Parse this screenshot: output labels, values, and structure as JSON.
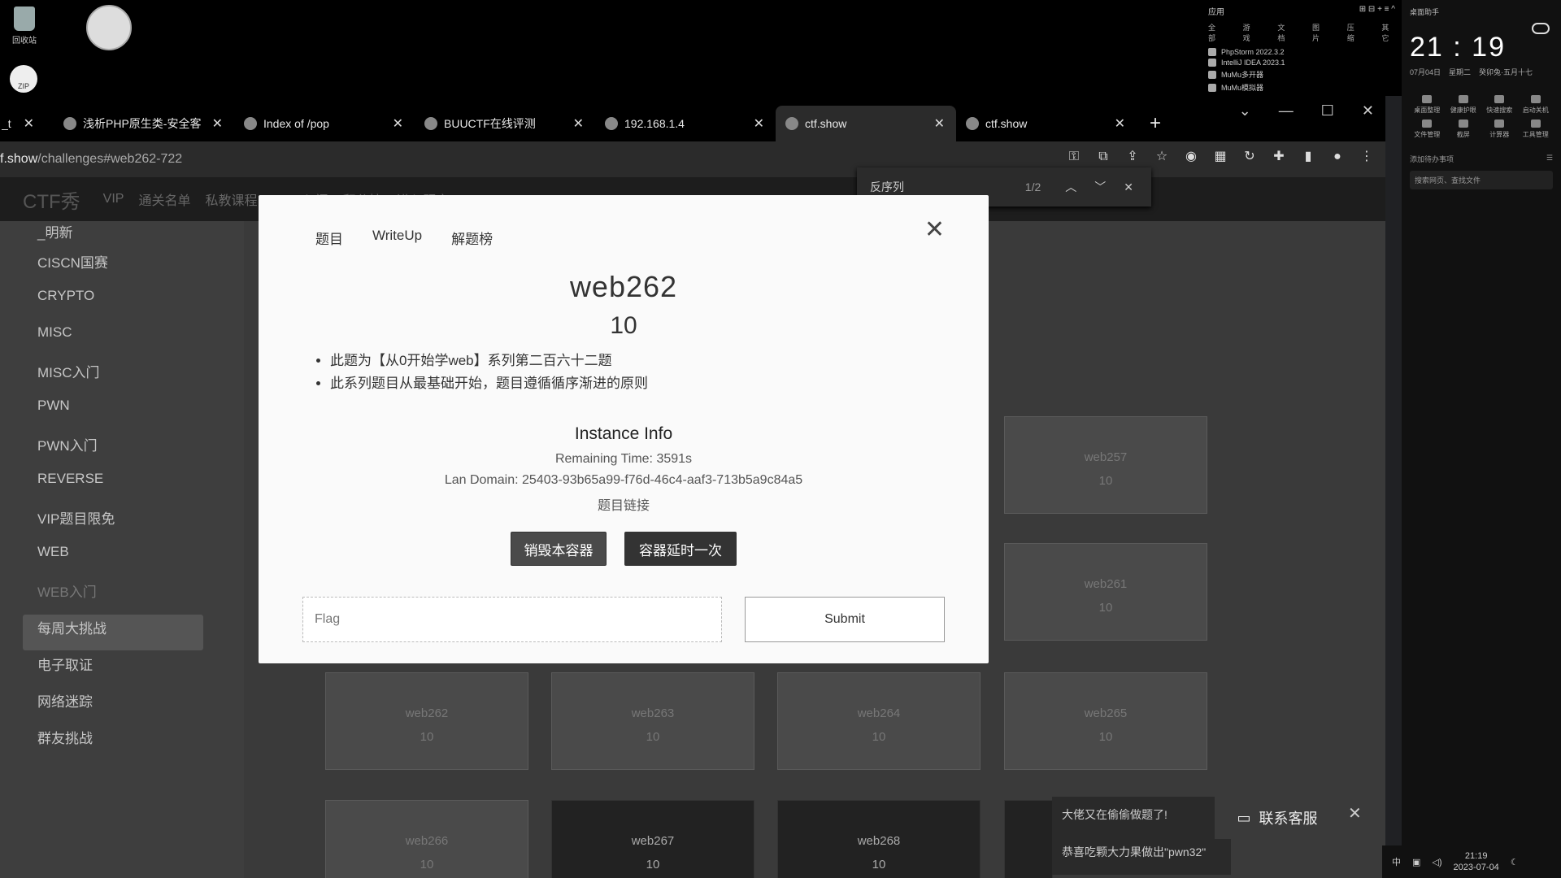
{
  "desktop": {
    "recycle_label": "回收站",
    "zip_label": "ZIP"
  },
  "apps_panel": {
    "title": "应用",
    "tabs": [
      "全部",
      "游戏",
      "文档",
      "图片",
      "压缩",
      "其它"
    ],
    "apps": [
      "PhpStorm 2022.3.2",
      "IntelliJ IDEA 2023.1",
      "MuMu多开器",
      "MuMu模拟器"
    ]
  },
  "clock": {
    "title": "桌面助手",
    "time": "21 : 19",
    "date": "07月04日",
    "weekday": "星期二",
    "lunar": "癸卯兔·五月十七",
    "tools": [
      "桌面整理",
      "健康护眼",
      "快速搜索",
      "启动关机",
      "文件管理",
      "截屏",
      "计算器",
      "工具管理"
    ],
    "todo": "添加待办事项",
    "search_placeholder": "搜索网页、查找文件"
  },
  "browser": {
    "tabs": [
      {
        "title": "_t",
        "active": false
      },
      {
        "title": "浅析PHP原生类-安全客",
        "active": false
      },
      {
        "title": "Index of /pop",
        "active": false
      },
      {
        "title": "BUUCTF在线评测",
        "active": false
      },
      {
        "title": "192.168.1.4",
        "active": false
      },
      {
        "title": "ctf.show",
        "active": true
      },
      {
        "title": "ctf.show",
        "active": false
      }
    ],
    "url_host": "f.show",
    "url_path": "/challenges#web262-722"
  },
  "find_bar": {
    "query": "反序列",
    "count": "1/2"
  },
  "site": {
    "logo": "CTF秀",
    "nav": [
      "VIP",
      "通关名单",
      "私教课程",
      "PWN入门",
      "积分榜",
      "进入题库"
    ],
    "sidebar": [
      "_明新",
      "CISCN国赛",
      "CRYPTO",
      "MISC",
      "MISC入门",
      "PWN",
      "PWN入门",
      "REVERSE",
      "VIP题目限免",
      "WEB",
      "WEB入门",
      "每周大挑战",
      "电子取证",
      "网络迷踪",
      "群友挑战"
    ],
    "cards": [
      {
        "name": "web257",
        "score": "10"
      },
      {
        "name": "web261",
        "score": "10"
      },
      {
        "name": "web262",
        "score": "10"
      },
      {
        "name": "web263",
        "score": "10"
      },
      {
        "name": "web264",
        "score": "10"
      },
      {
        "name": "web265",
        "score": "10"
      },
      {
        "name": "web266",
        "score": "10"
      },
      {
        "name": "web267",
        "score": "10"
      },
      {
        "name": "web268",
        "score": "10"
      }
    ]
  },
  "modal": {
    "tabs": [
      "题目",
      "WriteUp",
      "解题榜"
    ],
    "title": "web262",
    "score": "10",
    "desc": [
      "此题为【从0开始学web】系列第二百六十二题",
      "此系列题目从最基础开始，题目遵循循序渐进的原则"
    ],
    "instance_title": "Instance Info",
    "remaining": "Remaining Time: 3591s",
    "lan_domain": "Lan Domain: 25403-93b65a99-f76d-46c4-aaf3-713b5a9c84a5",
    "link_label": "题目链接",
    "destroy_btn": "销毁本容器",
    "extend_btn": "容器延时一次",
    "flag_placeholder": "Flag",
    "submit": "Submit"
  },
  "notification": {
    "line1": "大佬又在偷偷做题了!",
    "line2": "恭喜吃颗大力果做出\"pwn32\"",
    "service": "联系客服"
  },
  "tray": {
    "ime": "中",
    "time": "21:19",
    "date": "2023-07-04"
  }
}
